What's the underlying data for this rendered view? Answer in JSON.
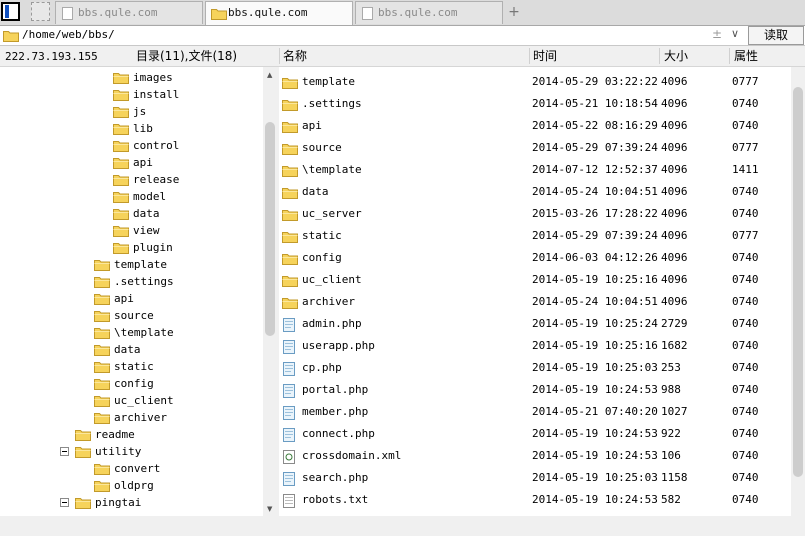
{
  "tabs": {
    "items": [
      {
        "label": "bbs.qule.com",
        "active": false
      },
      {
        "label": "bbs.qule.com",
        "active": true
      },
      {
        "label": "bbs.qule.com",
        "active": false
      }
    ],
    "add_label": "+"
  },
  "path_bar": {
    "path": "/home/web/bbs/",
    "plus_glyph": "±",
    "dropdown_glyph": "∨",
    "read_button": "读取"
  },
  "left_header": {
    "ip": "222.73.193.155",
    "dir_count": "目录(11),文件(18)"
  },
  "columns": {
    "name": "名称",
    "time": "时间",
    "size": "大小",
    "perm": "属性"
  },
  "tree": [
    {
      "label": "images",
      "level": 3
    },
    {
      "label": "install",
      "level": 3
    },
    {
      "label": "js",
      "level": 3
    },
    {
      "label": "lib",
      "level": 3
    },
    {
      "label": "control",
      "level": 3
    },
    {
      "label": "api",
      "level": 3
    },
    {
      "label": "release",
      "level": 3
    },
    {
      "label": "model",
      "level": 3
    },
    {
      "label": "data",
      "level": 3
    },
    {
      "label": "view",
      "level": 3
    },
    {
      "label": "plugin",
      "level": 3
    },
    {
      "label": "template",
      "level": 2
    },
    {
      "label": ".settings",
      "level": 2
    },
    {
      "label": "api",
      "level": 2
    },
    {
      "label": "source",
      "level": 2
    },
    {
      "label": "\\template",
      "level": 2
    },
    {
      "label": "data",
      "level": 2
    },
    {
      "label": "static",
      "level": 2
    },
    {
      "label": "config",
      "level": 2
    },
    {
      "label": "uc_client",
      "level": 2
    },
    {
      "label": "archiver",
      "level": 2
    },
    {
      "label": "readme",
      "level": 1
    },
    {
      "label": "utility",
      "level": 1,
      "expanded": true
    },
    {
      "label": "convert",
      "level": 2
    },
    {
      "label": "oldprg",
      "level": 2
    },
    {
      "label": "pingtai",
      "level": 1,
      "expanded": true
    }
  ],
  "files": [
    {
      "name": "template",
      "time": "2014-05-29 03:22:22",
      "size": "4096",
      "perm": "0777",
      "icon": "folder-icon"
    },
    {
      "name": ".settings",
      "time": "2014-05-21 10:18:54",
      "size": "4096",
      "perm": "0740",
      "icon": "folder-icon"
    },
    {
      "name": "api",
      "time": "2014-05-22 08:16:29",
      "size": "4096",
      "perm": "0740",
      "icon": "folder-icon"
    },
    {
      "name": "source",
      "time": "2014-05-29 07:39:24",
      "size": "4096",
      "perm": "0777",
      "icon": "folder-icon"
    },
    {
      "name": "\\template",
      "time": "2014-07-12 12:52:37",
      "size": "4096",
      "perm": "1411",
      "icon": "folder-icon"
    },
    {
      "name": "data",
      "time": "2014-05-24 10:04:51",
      "size": "4096",
      "perm": "0740",
      "icon": "folder-icon"
    },
    {
      "name": "uc_server",
      "time": "2015-03-26 17:28:22",
      "size": "4096",
      "perm": "0740",
      "icon": "folder-icon"
    },
    {
      "name": "static",
      "time": "2014-05-29 07:39:24",
      "size": "4096",
      "perm": "0777",
      "icon": "folder-icon"
    },
    {
      "name": "config",
      "time": "2014-06-03 04:12:26",
      "size": "4096",
      "perm": "0740",
      "icon": "folder-icon"
    },
    {
      "name": "uc_client",
      "time": "2014-05-19 10:25:16",
      "size": "4096",
      "perm": "0740",
      "icon": "folder-icon"
    },
    {
      "name": "archiver",
      "time": "2014-05-24 10:04:51",
      "size": "4096",
      "perm": "0740",
      "icon": "folder-icon"
    },
    {
      "name": "admin.php",
      "time": "2014-05-19 10:25:24",
      "size": "2729",
      "perm": "0740",
      "icon": "php-file-icon"
    },
    {
      "name": "userapp.php",
      "time": "2014-05-19 10:25:16",
      "size": "1682",
      "perm": "0740",
      "icon": "php-file-icon"
    },
    {
      "name": "cp.php",
      "time": "2014-05-19 10:25:03",
      "size": "253",
      "perm": "0740",
      "icon": "php-file-icon"
    },
    {
      "name": "portal.php",
      "time": "2014-05-19 10:24:53",
      "size": "988",
      "perm": "0740",
      "icon": "php-file-icon"
    },
    {
      "name": "member.php",
      "time": "2014-05-21 07:40:20",
      "size": "1027",
      "perm": "0740",
      "icon": "php-file-icon"
    },
    {
      "name": "connect.php",
      "time": "2014-05-19 10:24:53",
      "size": "922",
      "perm": "0740",
      "icon": "php-file-icon"
    },
    {
      "name": "crossdomain.xml",
      "time": "2014-05-19 10:24:53",
      "size": "106",
      "perm": "0740",
      "icon": "xml-file-icon"
    },
    {
      "name": "search.php",
      "time": "2014-05-19 10:25:03",
      "size": "1158",
      "perm": "0740",
      "icon": "php-file-icon"
    },
    {
      "name": "robots.txt",
      "time": "2014-05-19 10:24:53",
      "size": "582",
      "perm": "0740",
      "icon": "text-file-icon"
    }
  ]
}
